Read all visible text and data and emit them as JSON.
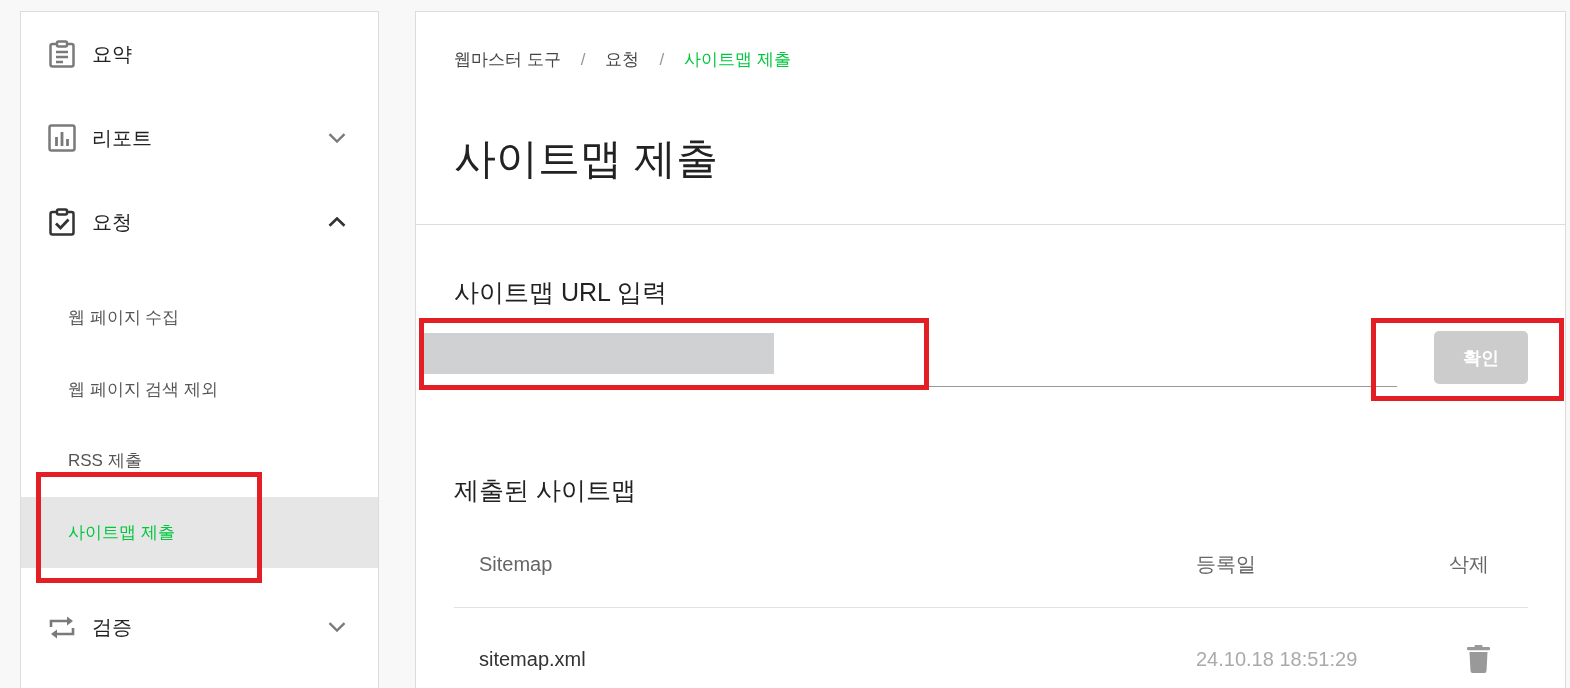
{
  "sidebar": {
    "items": [
      {
        "label": "요약"
      },
      {
        "label": "리포트",
        "expanded": false
      },
      {
        "label": "요청",
        "expanded": true,
        "children": [
          {
            "label": "웹 페이지 수집",
            "selected": false,
            "highlighted": false
          },
          {
            "label": "웹 페이지 검색 제외",
            "selected": false,
            "highlighted": false
          },
          {
            "label": "RSS 제출",
            "selected": false,
            "highlighted": false
          },
          {
            "label": "사이트맵 제출",
            "selected": true,
            "highlighted": true
          }
        ]
      },
      {
        "label": "검증",
        "expanded": false
      }
    ]
  },
  "breadcrumb": {
    "items": [
      {
        "label": "웹마스터 도구",
        "current": false
      },
      {
        "label": "요청",
        "current": false
      },
      {
        "label": "사이트맵 제출",
        "current": true
      }
    ],
    "separators": [
      "/",
      "/"
    ]
  },
  "page_title": "사이트맵 제출",
  "url_section": {
    "label": "사이트맵 URL 입력",
    "input": {
      "redacted": true,
      "highlighted": true
    },
    "button": {
      "label": "확인",
      "disabled": true,
      "highlighted": true
    }
  },
  "submitted_section": {
    "title": "제출된 사이트맵",
    "table": {
      "columns": [
        "Sitemap",
        "등록일",
        "삭제"
      ],
      "rows": [
        {
          "sitemap": "sitemap.xml",
          "registered": "24.10.18 18:51:29"
        }
      ]
    }
  }
}
